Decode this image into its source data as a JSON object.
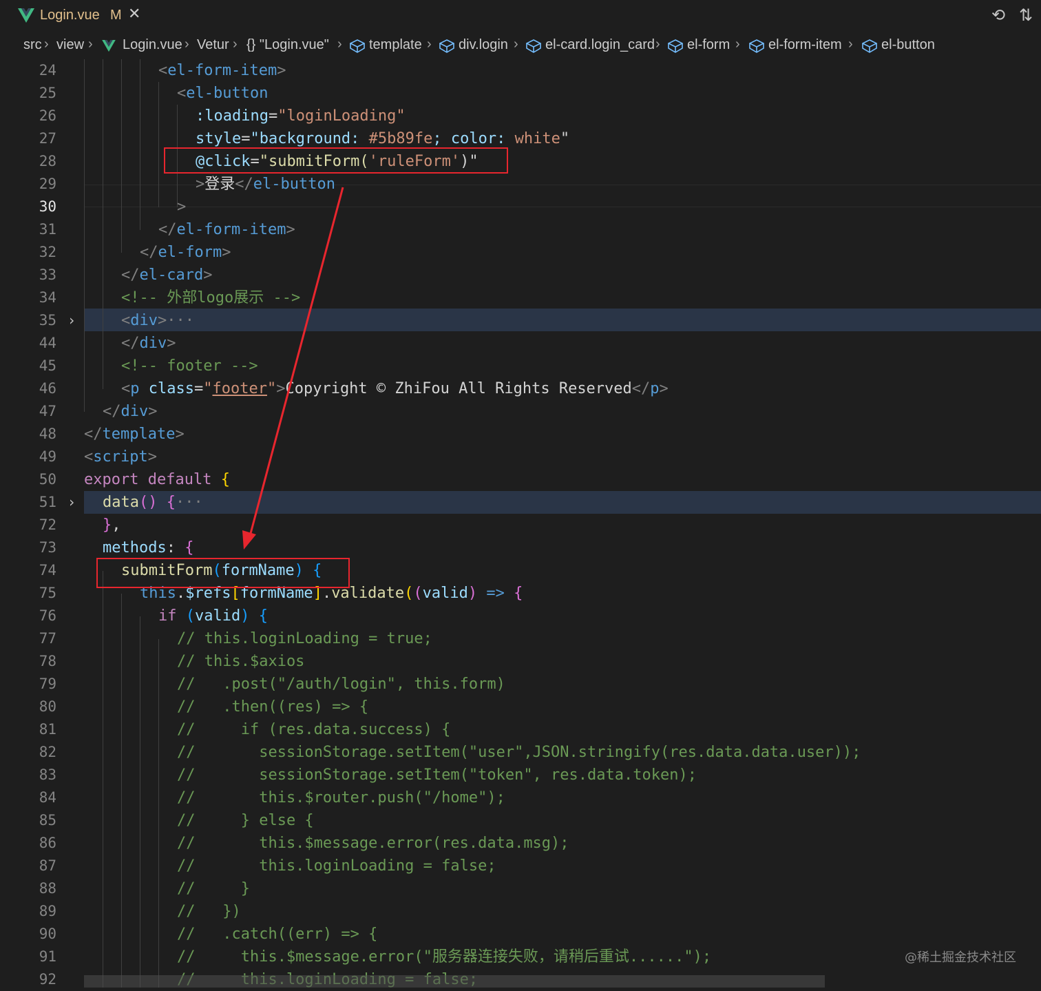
{
  "tab": {
    "title": "Login.vue",
    "modified": "M",
    "close": "✕"
  },
  "top_icons": {
    "history": "⟲",
    "compare": "⇅"
  },
  "breadcrumb": [
    "src",
    "view",
    "Login.vue",
    "Vetur",
    "{} \"Login.vue\"",
    "template",
    "div.login",
    "el-card.login_card",
    "el-form",
    "el-form-item",
    "el-button"
  ],
  "lines": [
    {
      "n": "24"
    },
    {
      "n": "25"
    },
    {
      "n": "26"
    },
    {
      "n": "27"
    },
    {
      "n": "28"
    },
    {
      "n": "29"
    },
    {
      "n": "30"
    },
    {
      "n": "31"
    },
    {
      "n": "32"
    },
    {
      "n": "33"
    },
    {
      "n": "34"
    },
    {
      "n": "35"
    },
    {
      "n": "44"
    },
    {
      "n": "45"
    },
    {
      "n": "46"
    },
    {
      "n": "47"
    },
    {
      "n": "48"
    },
    {
      "n": "49"
    },
    {
      "n": "50"
    },
    {
      "n": "51"
    },
    {
      "n": "72"
    },
    {
      "n": "73"
    },
    {
      "n": "74"
    },
    {
      "n": "75"
    },
    {
      "n": "76"
    },
    {
      "n": "77"
    },
    {
      "n": "78"
    },
    {
      "n": "79"
    },
    {
      "n": "80"
    },
    {
      "n": "81"
    },
    {
      "n": "82"
    },
    {
      "n": "83"
    },
    {
      "n": "84"
    },
    {
      "n": "85"
    },
    {
      "n": "86"
    },
    {
      "n": "87"
    },
    {
      "n": "88"
    },
    {
      "n": "89"
    },
    {
      "n": "90"
    },
    {
      "n": "91"
    },
    {
      "n": "92"
    }
  ],
  "code": {
    "l24": [
      "<",
      "el-form-item",
      ">"
    ],
    "l25": [
      "<",
      "el-button"
    ],
    "l26": [
      ":loading",
      "=",
      "\"loginLoading\""
    ],
    "l27": [
      "style",
      "=",
      "\"background: ",
      "#5b89fe",
      "; color: ",
      "white",
      "\""
    ],
    "l28": [
      "@click",
      "=",
      "\"submitForm(",
      "'ruleForm'",
      ")\""
    ],
    "l29": [
      ">",
      "登录",
      "</",
      "el-button"
    ],
    "l30": [
      ">"
    ],
    "l31": [
      "</",
      "el-form-item",
      ">"
    ],
    "l32": [
      "</",
      "el-form",
      ">"
    ],
    "l33": [
      "</",
      "el-card",
      ">"
    ],
    "l34": "<!-- 外部logo展示 -->",
    "l35": [
      "<",
      "div",
      ">",
      "···"
    ],
    "l44": [
      "</",
      "div",
      ">"
    ],
    "l45": "<!-- footer -->",
    "l46": [
      "<",
      "p",
      " class",
      "=",
      "\"",
      "footer",
      "\"",
      ">",
      "Copyright © ZhiFou All Rights Reserved",
      "</",
      "p",
      ">"
    ],
    "l47": [
      "</",
      "div",
      ">"
    ],
    "l48": [
      "</",
      "template",
      ">"
    ],
    "l49": [
      "<",
      "script",
      ">"
    ],
    "l50": [
      "export",
      " default ",
      "{"
    ],
    "l51": [
      "data",
      "()",
      " {",
      "···"
    ],
    "l72": [
      "}",
      ","
    ],
    "l73": [
      "methods",
      ": ",
      "{"
    ],
    "l74": [
      "submitForm",
      "(",
      "formName",
      ")",
      " {"
    ],
    "l75": [
      "this",
      ".",
      "$refs",
      "[",
      "formName",
      "]",
      ".",
      "validate",
      "(",
      "(",
      "valid",
      ")",
      " => ",
      "{"
    ],
    "l76": [
      "if",
      " ",
      "(",
      "valid",
      ")",
      " {"
    ],
    "l77": "// this.loginLoading = true;",
    "l78": "// this.$axios",
    "l79": "//   .post(\"/auth/login\", this.form)",
    "l80": "//   .then((res) => {",
    "l81": "//     if (res.data.success) {",
    "l82": "//       sessionStorage.setItem(\"user\",JSON.stringify(res.data.data.user));",
    "l83": "//       sessionStorage.setItem(\"token\", res.data.token);",
    "l84": "//       this.$router.push(\"/home\");",
    "l85": "//     } else {",
    "l86": "//       this.$message.error(res.data.msg);",
    "l87": "//       this.loginLoading = false;",
    "l88": "//     }",
    "l89": "//   })",
    "l90": "//   .catch((err) => {",
    "l91": "//     this.$message.error(\"服务器连接失败，请稍后重试......\");",
    "l92": "//     this.loginLoading = false;"
  },
  "watermark": "@稀土掘金技术社区",
  "colors": {
    "background": "#1e1e1e",
    "annotation": "#e8262e",
    "tag": "#569cd6",
    "string": "#ce9178",
    "comment": "#6a9955"
  }
}
